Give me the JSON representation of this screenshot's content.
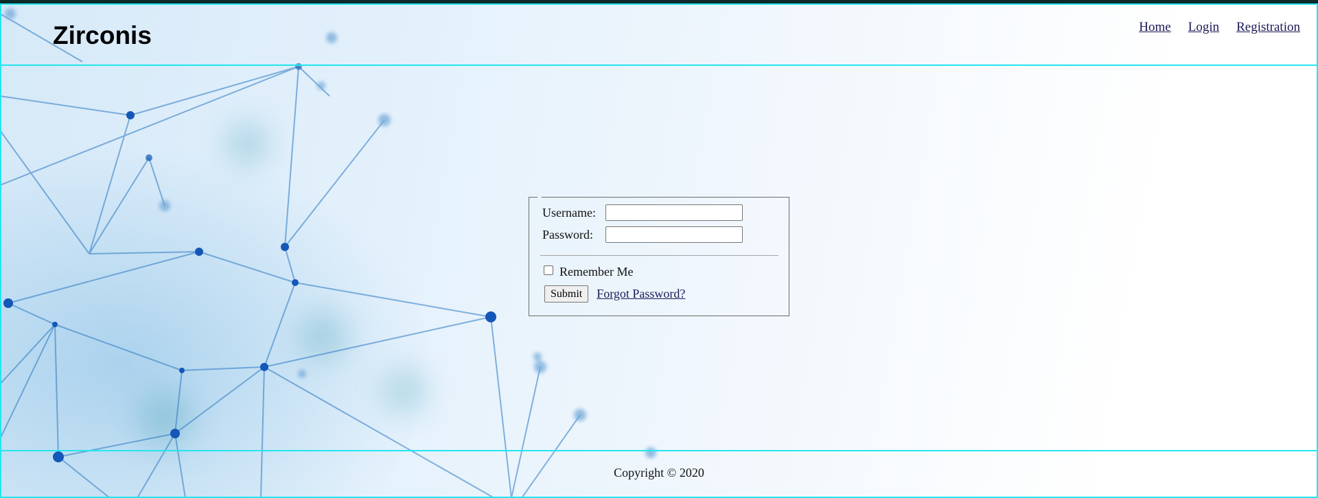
{
  "header": {
    "brand": "Zirconis",
    "nav": [
      {
        "label": "Home"
      },
      {
        "label": "Login"
      },
      {
        "label": "Registration"
      }
    ]
  },
  "login": {
    "username_label": "Username:",
    "username_value": "",
    "password_label": "Password:",
    "password_value": "",
    "remember_label": "Remember Me",
    "remember_checked": false,
    "submit_label": "Submit",
    "forgot_label": "Forgot Password?"
  },
  "footer": {
    "copyright": "Copyright © 2020"
  },
  "colors": {
    "frame_border": "#22e6f0",
    "link": "#1a1a55",
    "network_line": "#2a78c2",
    "network_node": "#1457b8"
  }
}
